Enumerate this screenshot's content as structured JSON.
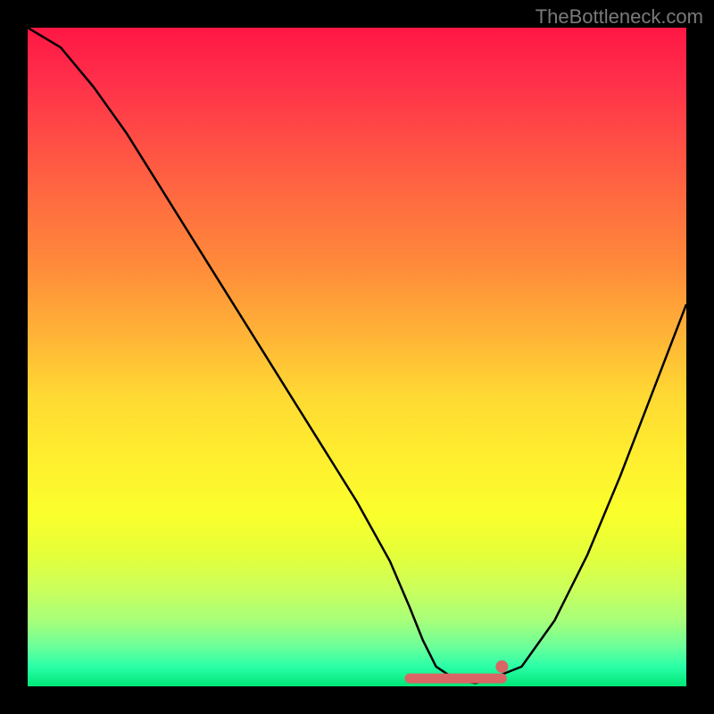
{
  "watermark": "TheBottleneck.com",
  "chart_data": {
    "type": "line",
    "title": "",
    "xlabel": "",
    "ylabel": "",
    "xlim": [
      0,
      100
    ],
    "ylim": [
      0,
      100
    ],
    "series": [
      {
        "name": "bottleneck-curve",
        "x": [
          0,
          5,
          10,
          15,
          20,
          25,
          30,
          35,
          40,
          45,
          50,
          55,
          58,
          60,
          62,
          65,
          68,
          70,
          75,
          80,
          85,
          90,
          95,
          100
        ],
        "y": [
          100,
          97,
          91,
          84,
          76,
          68,
          60,
          52,
          44,
          36,
          28,
          19,
          12,
          7,
          3,
          1,
          0.5,
          1,
          3,
          10,
          20,
          32,
          45,
          58
        ]
      }
    ],
    "flat_region": {
      "x_start": 58,
      "x_end": 72,
      "color": "#d96565"
    },
    "marker_dot": {
      "x": 72,
      "y": 3,
      "color": "#d96565"
    },
    "gradient_stops": [
      {
        "pos": 0,
        "color": "#ff1744"
      },
      {
        "pos": 50,
        "color": "#ffd933"
      },
      {
        "pos": 100,
        "color": "#00e676"
      }
    ]
  }
}
